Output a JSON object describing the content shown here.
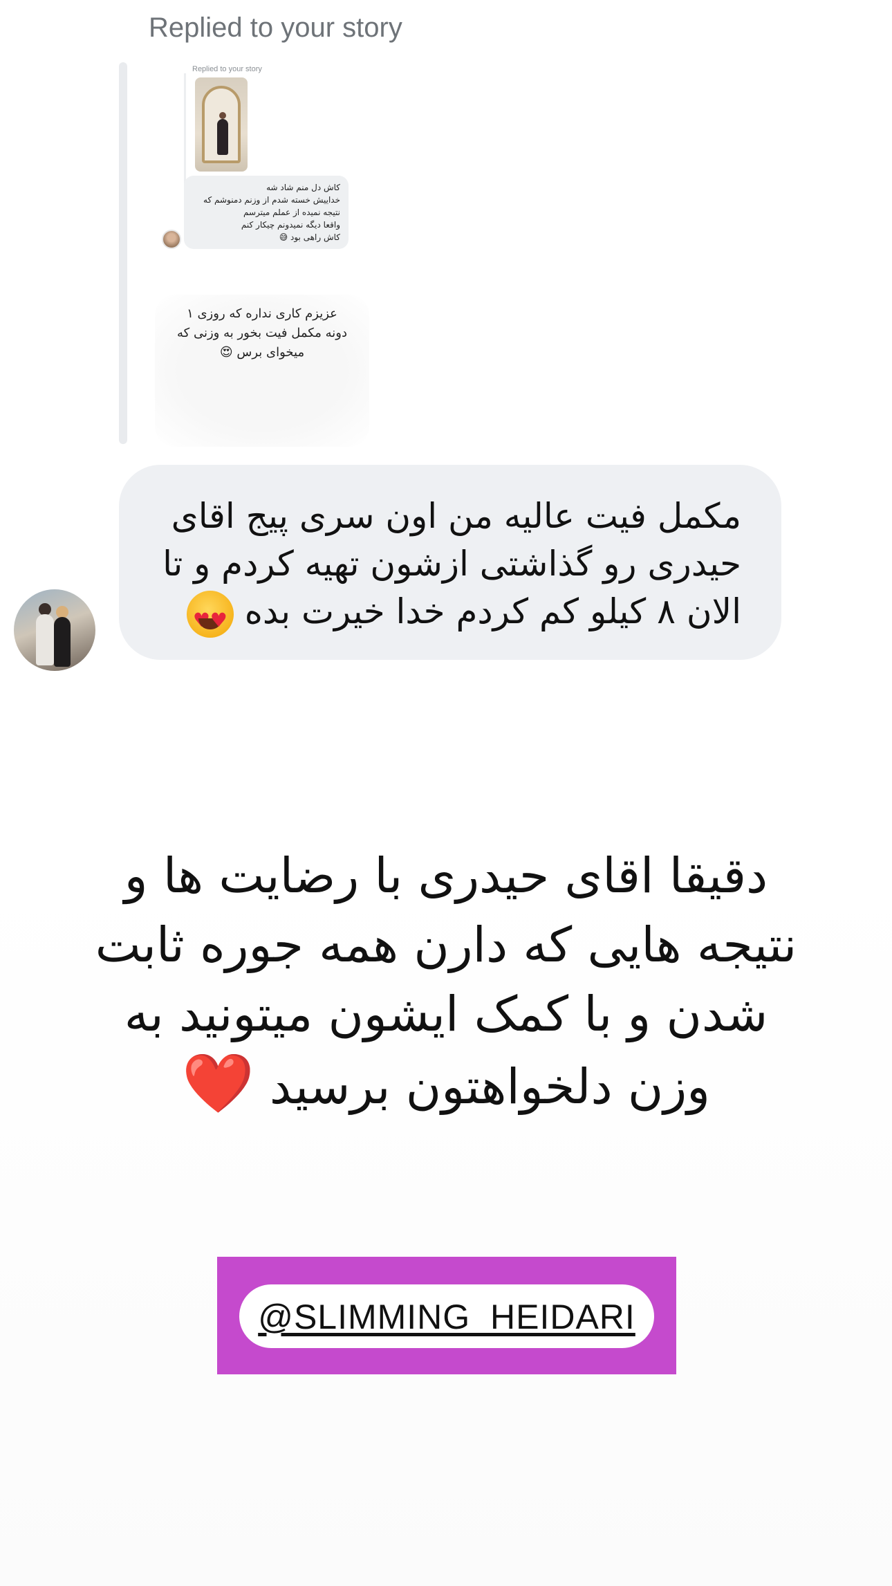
{
  "header": {
    "replied_label": "Replied to your story"
  },
  "nested_screenshot": {
    "label": "Replied to your story",
    "message_lines": [
      "کاش دل منم شاد شه",
      "خداییش خسته شدم از وزنم دمنوشم که",
      "نتیجه نمیده از عملم میترسم",
      "واقعا دیگه نمیدونم چیکار کنم",
      "کاش راهی بود 😅"
    ],
    "reply_lines": [
      "عزیزم کاری نداره که روزی ۱",
      "دونه مکمل فیت بخور به وزنی که",
      "میخوای برس 😍"
    ]
  },
  "dm_message": {
    "lines": [
      "مکمل فیت عالیه من اون سری پیج اقای",
      "حیدری رو گذاشتی ازشون تهیه کردم و تا",
      "الان ۸ کیلو کم کردم خدا خیرت بده"
    ],
    "emoji": "heart-eyes-emoji"
  },
  "caption": {
    "lines": [
      "دقیقا اقای حیدری با رضایت ها و",
      "نتیجه هایی که دارن همه جوره ثابت",
      "شدن و با کمک ایشون میتونید به",
      "وزن دلخواهتون برسید"
    ],
    "heart": "❤️"
  },
  "handle_sticker": {
    "handle": "@SLIMMING_HEIDARI",
    "background_color": "#c54acd"
  }
}
